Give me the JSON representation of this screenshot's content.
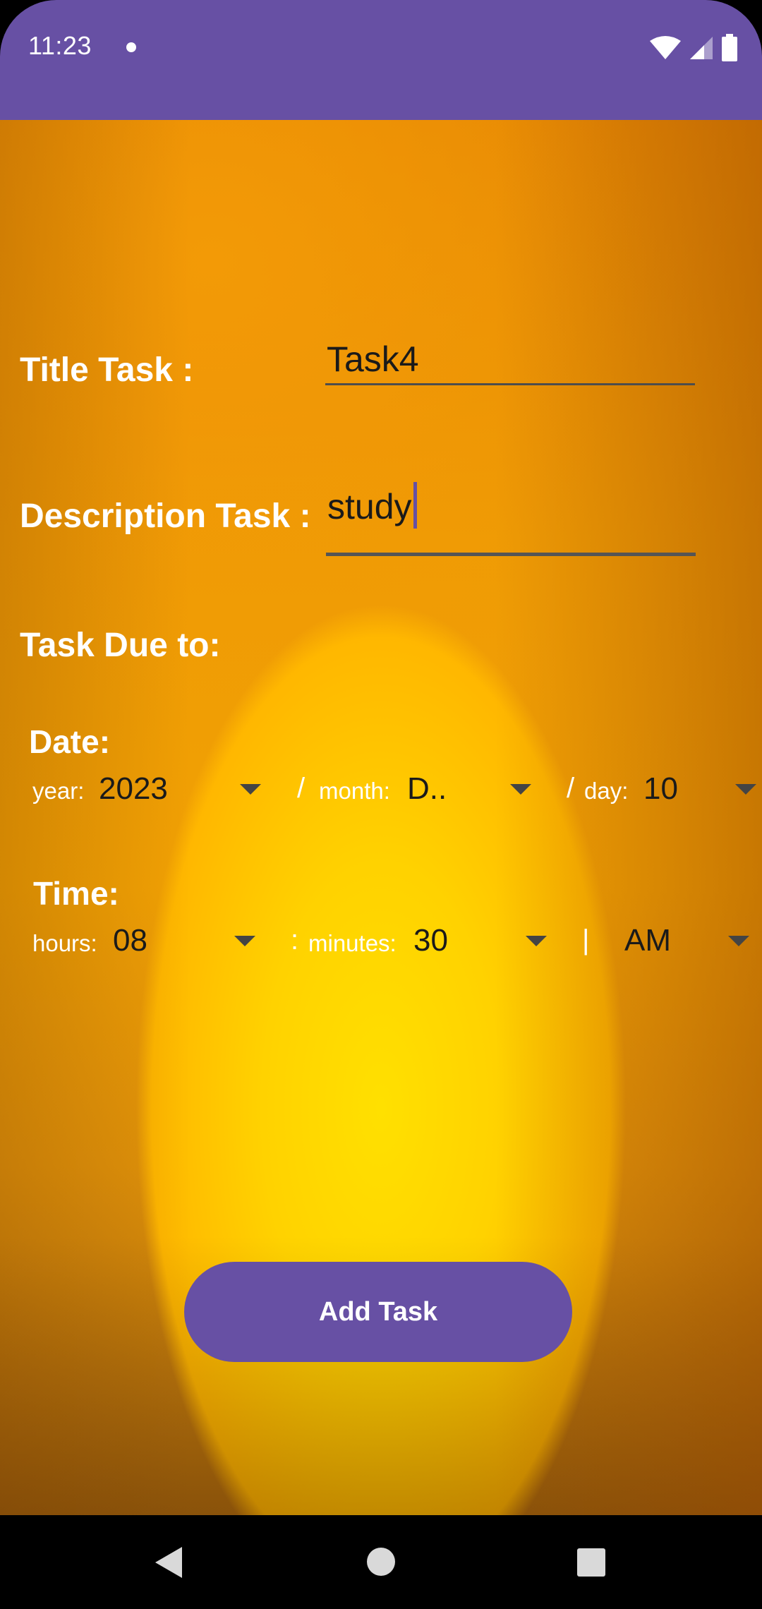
{
  "status_bar": {
    "time": "11:23",
    "icons": [
      "notification-dot-icon",
      "wifi-icon",
      "cell-signal-icon",
      "battery-icon"
    ]
  },
  "colors": {
    "accent": "#6750a4",
    "label_text": "#ffffff",
    "field_text": "#1a1a1a"
  },
  "form": {
    "title_label": "Title Task :",
    "title_value": "Task4",
    "description_label": "Description Task :",
    "description_value": "study",
    "due_label": "Task Due to:",
    "date_label": "Date:",
    "year_label": "year:",
    "year_value": "2023",
    "date_sep1": "/",
    "month_label": "month:",
    "month_value": "D..",
    "date_sep2": "/",
    "day_label": "day:",
    "day_value": "10",
    "time_label": "Time:",
    "hours_label": "hours:",
    "hours_value": "08",
    "time_sep1": ":",
    "minutes_label": "minutes:",
    "minutes_value": "30",
    "time_sep2": "|",
    "ampm_value": "AM"
  },
  "actions": {
    "add_task_label": "Add Task"
  },
  "nav_bar": {
    "icons": [
      "back-icon",
      "home-icon",
      "recents-icon"
    ]
  }
}
